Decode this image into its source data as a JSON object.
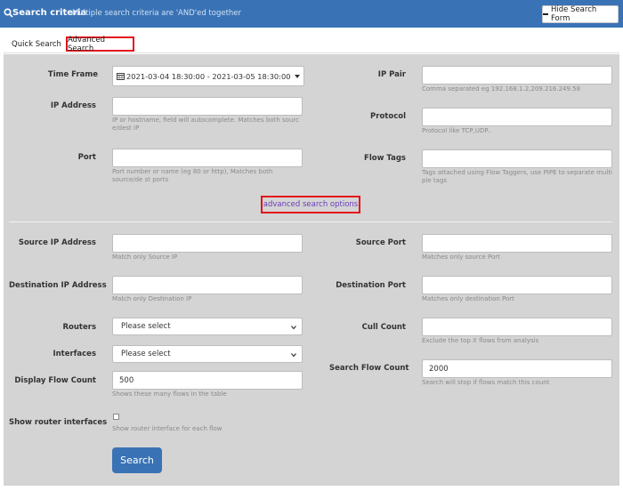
{
  "header": {
    "title": "Search criteria",
    "subtitle": "Multiple search criteria are 'AND'ed together",
    "hide_button": "Hide Search Form",
    "search_icon": "search-icon",
    "minus_icon": "minus-icon"
  },
  "tabs": {
    "quick": "Quick Search",
    "advanced": "Advanced Search"
  },
  "basic": {
    "time_frame": {
      "label": "Time Frame",
      "value": "2021-03-04 18:30:00 - 2021-03-05 18:30:00"
    },
    "ip_address": {
      "label": "IP Address",
      "help": "IP or hostname, field will autocomplete. Matches both sourc e/dest IP"
    },
    "port": {
      "label": "Port",
      "help": "Port number or name (eg 80 or http), Matches both source/de st ports"
    },
    "ip_pair": {
      "label": "IP Pair",
      "help": "Comma separated eg 192.168.1.2,209.216.249.58"
    },
    "protocol": {
      "label": "Protocol",
      "help": "Protocol like TCP,UDP.."
    },
    "flow_tags": {
      "label": "Flow Tags",
      "help": "Tags attached using Flow Taggers, use PIPE to separate multi ple tags"
    }
  },
  "advanced_link": "advanced search options",
  "advanced": {
    "source_ip": {
      "label": "Source IP Address",
      "help": "Match only Source IP"
    },
    "dest_ip": {
      "label": "Destination IP Address",
      "help": "Match only Destination IP"
    },
    "routers": {
      "label": "Routers",
      "value": "Please select"
    },
    "interfaces": {
      "label": "Interfaces",
      "value": "Please select"
    },
    "display_flow_count": {
      "label": "Display Flow Count",
      "value": "500",
      "help": "Shows these many flows in the table"
    },
    "show_router_interfaces": {
      "label": "Show router interfaces",
      "help": "Show router interface for each flow"
    },
    "source_port": {
      "label": "Source Port",
      "help": "Matches only source Port"
    },
    "dest_port": {
      "label": "Destination Port",
      "help": "Matches only destination Port"
    },
    "cull_count": {
      "label": "Cull Count",
      "help": "Exclude the top X flows from analysis"
    },
    "search_flow_count": {
      "label": "Search Flow Count",
      "value": "2000",
      "help": "Search will stop if flows match this count"
    }
  },
  "search_button": "Search",
  "colors": {
    "header": "#3a73b5",
    "highlight": "#e3141b",
    "panel": "#d4d4d4",
    "link": "#6a3cb8"
  }
}
